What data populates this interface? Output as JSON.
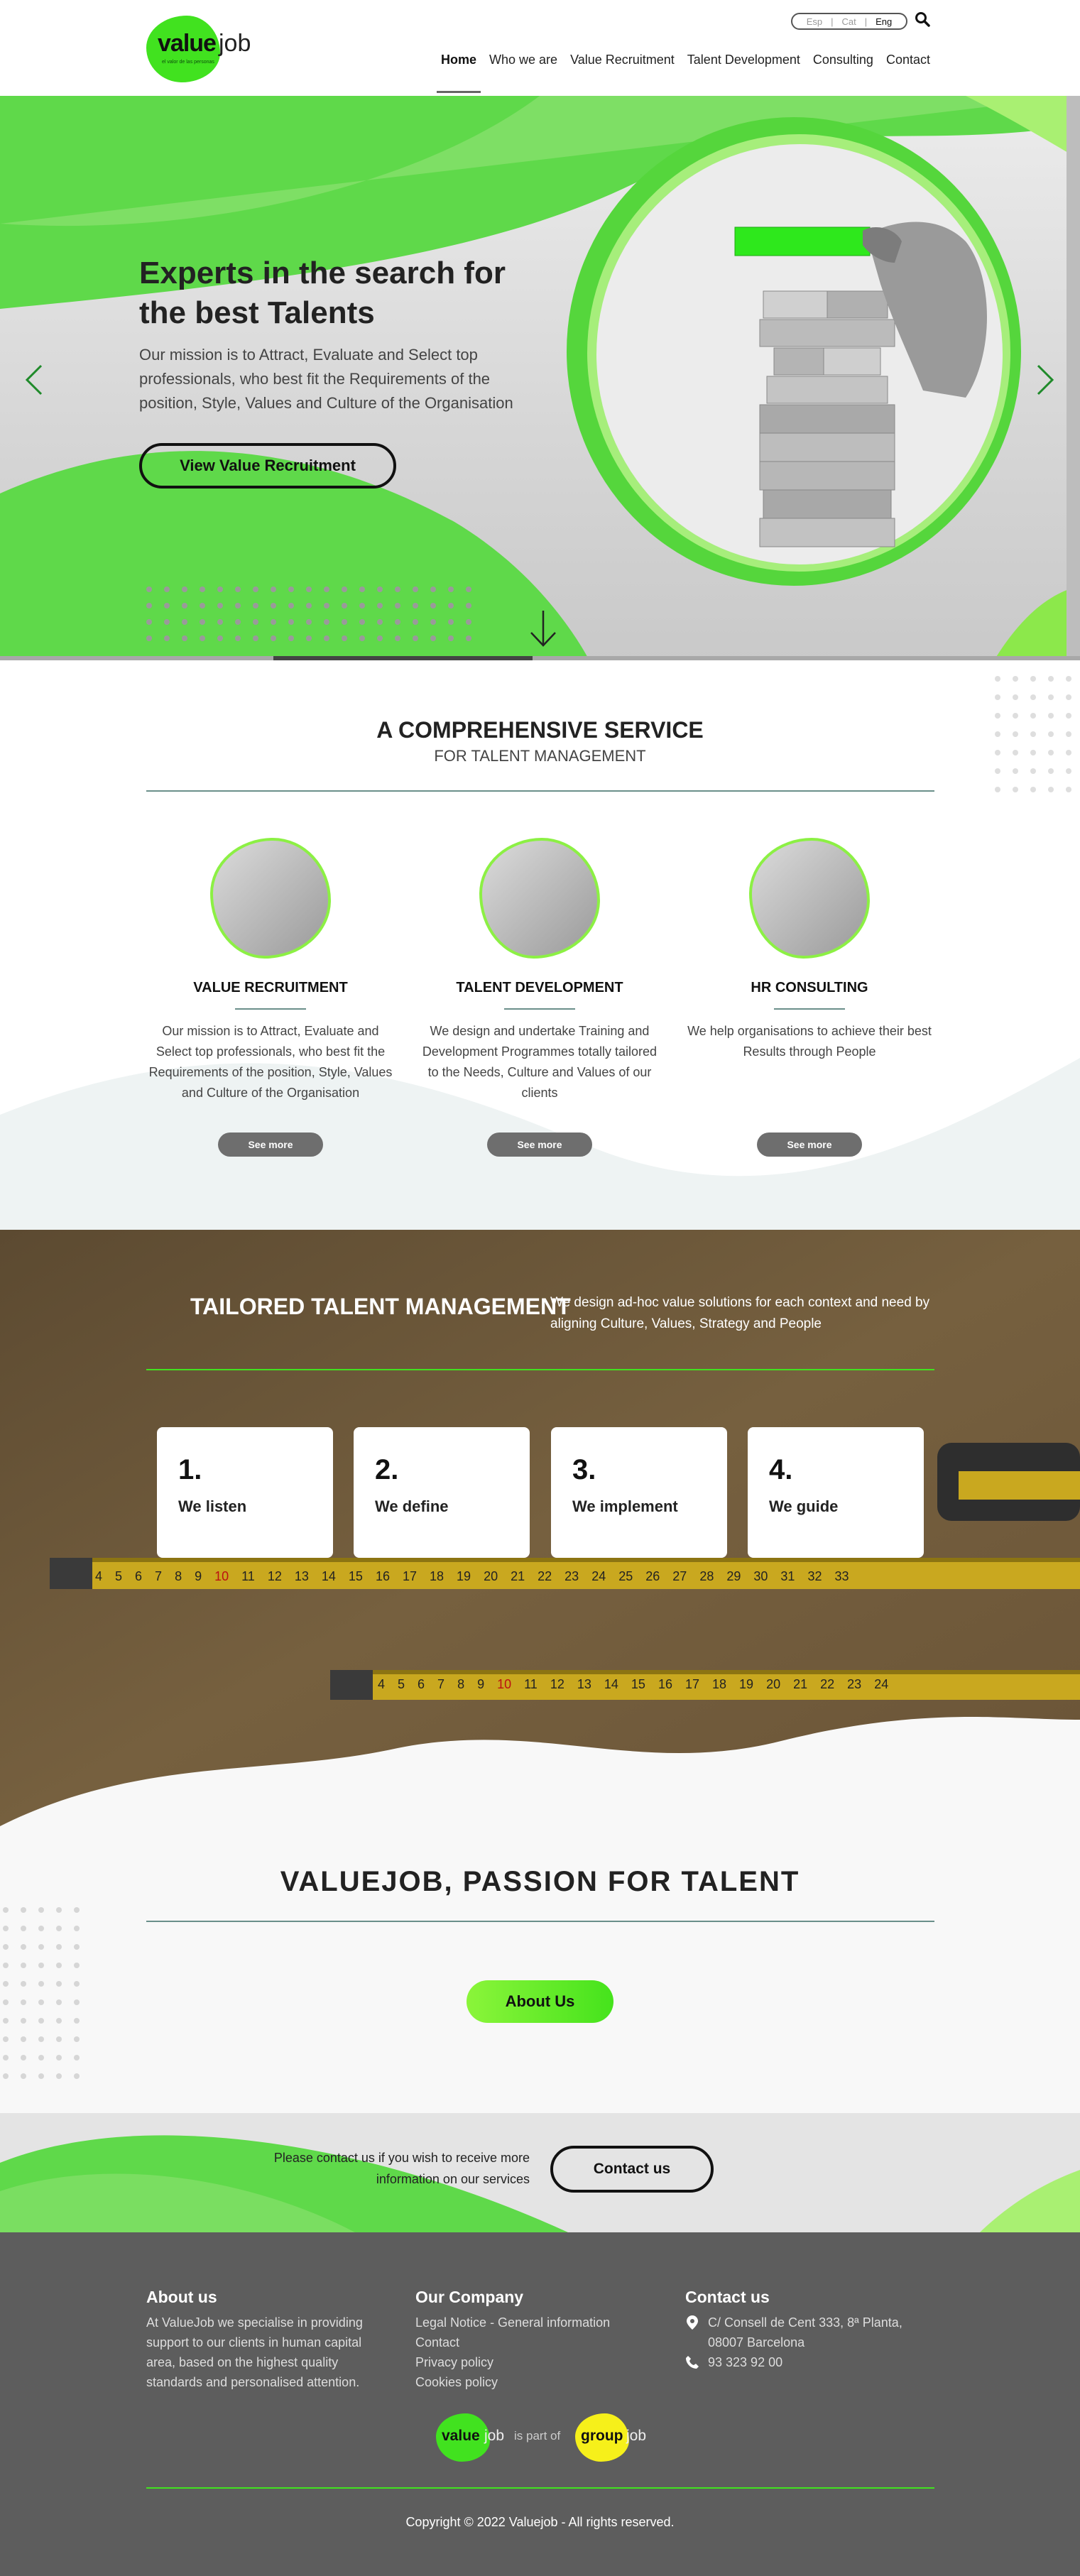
{
  "header": {
    "logo": {
      "value": "value",
      "job": "job",
      "tagline": "el valor de las personas"
    },
    "languages": [
      "Esp",
      "Cat",
      "Eng"
    ],
    "active_language": "Eng",
    "nav": [
      "Home",
      "Who we are",
      "Value Recruitment",
      "Talent Development",
      "Consulting",
      "Contact"
    ],
    "active_nav": "Home"
  },
  "hero": {
    "title": "Experts in the search for the best Talents",
    "text": "Our mission is to Attract, Evaluate and Select top professionals, who best fit the Requirements of the position, Style, Values and Culture of the Organisation",
    "button": "View Value Recruitment",
    "slider_progress": 0.24
  },
  "service": {
    "title": "A COMPREHENSIVE SERVICE",
    "subtitle": "FOR TALENT MANAGEMENT",
    "cards": [
      {
        "title": "VALUE RECRUITMENT",
        "text": "Our mission is to Attract, Evaluate and Select top professionals, who best fit the Requirements of the position, Style, Values and Culture of the Organisation",
        "button": "See more"
      },
      {
        "title": "TALENT DEVELOPMENT",
        "text": "We design and undertake Training and Development Programmes totally tailored to the Needs, Culture and Values of our clients",
        "button": "See more"
      },
      {
        "title": "HR CONSULTING",
        "text": "We help organisations to achieve their best Results through People",
        "button": "See more"
      }
    ]
  },
  "tailored": {
    "title": "TAILORED TALENT MANAGEMENT",
    "text": "We design ad-hoc value solutions for each context and need by aligning Culture, Values, Strategy and People",
    "steps": [
      {
        "number": "1.",
        "label": "We listen"
      },
      {
        "number": "2.",
        "label": "We define"
      },
      {
        "number": "3.",
        "label": "We implement"
      },
      {
        "number": "4.",
        "label": "We guide"
      }
    ],
    "tape_numbers_top": [
      "4",
      "5",
      "6",
      "7",
      "8",
      "9",
      "10",
      "11",
      "12",
      "13",
      "14",
      "15",
      "16",
      "17",
      "18",
      "19",
      "20",
      "21",
      "22",
      "23",
      "24",
      "25",
      "26",
      "27",
      "28",
      "29",
      "30",
      "31",
      "32",
      "33"
    ],
    "tape_numbers_bottom": [
      "4",
      "5",
      "6",
      "7",
      "8",
      "9",
      "10",
      "11",
      "12",
      "13",
      "14",
      "15",
      "16",
      "17",
      "18",
      "19",
      "20",
      "21",
      "22",
      "23",
      "24"
    ]
  },
  "passion": {
    "title": "VALUEJOB, PASSION FOR TALENT",
    "button": "About Us"
  },
  "contact_strip": {
    "text": "Please contact us if you wish to receive more information on our services",
    "button": "Contact us"
  },
  "footer": {
    "about": {
      "title": "About us",
      "text": "At ValueJob we specialise in providing support to our clients in human capital area, based on the highest quality standards and personalised attention."
    },
    "company": {
      "title": "Our Company",
      "links": [
        "Legal Notice - General information",
        "Contact",
        "Privacy policy",
        "Cookies policy"
      ]
    },
    "contact": {
      "title": "Contact us",
      "address": "C/ Consell de Cent 333, 8ª Planta, 08007 Barcelona",
      "phone": "93 323 92 00"
    },
    "group": {
      "value": "value",
      "job": "job",
      "is_part_of": "is part of",
      "group": "group",
      "group_job": "job"
    },
    "copyright": "Copyright © 2022 Valuejob - All rights reserved."
  },
  "colors": {
    "accent_green": "#41e21f",
    "footer_bg": "#5d5d5d",
    "group_yellow": "#f6f01a"
  }
}
